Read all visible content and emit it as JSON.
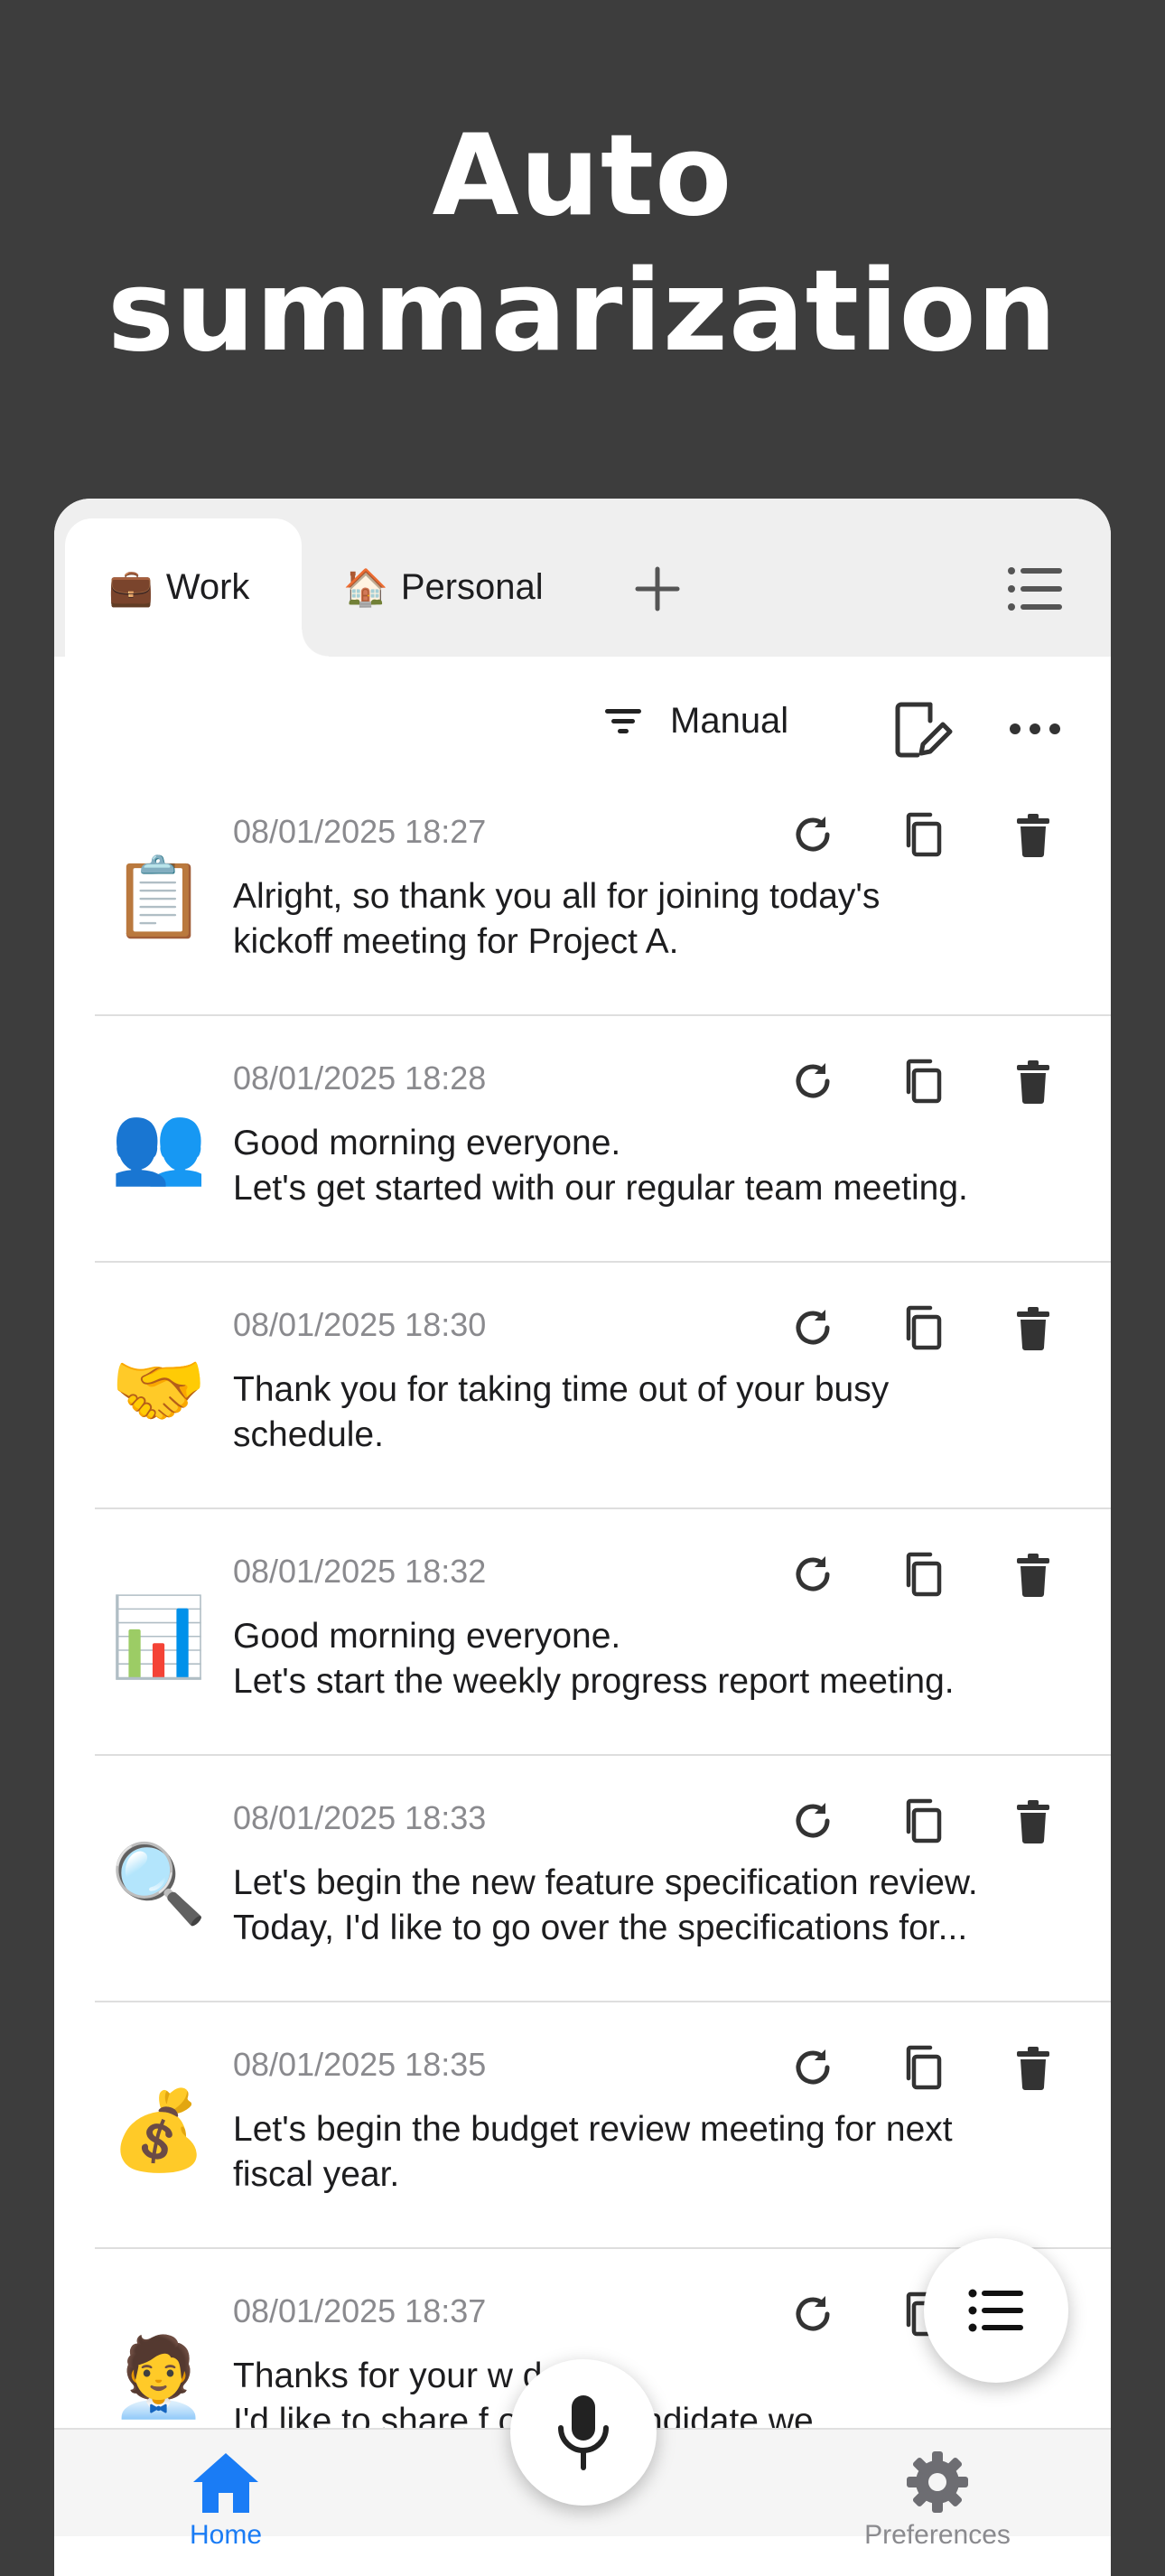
{
  "hero": {
    "line1": "Auto",
    "line2": "summarization"
  },
  "tabs": [
    {
      "icon": "briefcase-emoji",
      "emoji": "💼",
      "label": "Work",
      "active": true
    },
    {
      "icon": "house-emoji",
      "emoji": "🏠",
      "label": "Personal",
      "active": false
    }
  ],
  "toolbar": {
    "sort_label": "Manual"
  },
  "recordings": [
    {
      "emoji": "📋",
      "time": "08/01/2025 18:27",
      "text": "Alright, so thank you all for joining today's\nkickoff meeting for Project A."
    },
    {
      "emoji": "👥",
      "time": "08/01/2025 18:28",
      "text": "Good morning everyone.\nLet's get started with our regular team meeting."
    },
    {
      "emoji": "🤝",
      "time": "08/01/2025 18:30",
      "text": "Thank you for taking time out of your busy\nschedule."
    },
    {
      "emoji": "📊",
      "time": "08/01/2025 18:32",
      "text": "Good morning everyone.\nLet's start the weekly progress report meeting."
    },
    {
      "emoji": "🔍",
      "time": "08/01/2025 18:33",
      "text": "Let's begin the new feature specification review.\nToday, I'd like to go over the specifications for..."
    },
    {
      "emoji": "💰",
      "time": "08/01/2025 18:35",
      "text": "Let's begin the budget review meeting for next\nfiscal year."
    },
    {
      "emoji": "🧑‍💼",
      "time": "08/01/2025 18:37",
      "text": "Thanks for your w        day.\nI'd like to share f          on the candidate we"
    }
  ],
  "nav": {
    "home_label": "Home",
    "preferences_label": "Preferences"
  },
  "colors": {
    "accent": "#1a7cf5",
    "background": "#3d3d3d"
  }
}
